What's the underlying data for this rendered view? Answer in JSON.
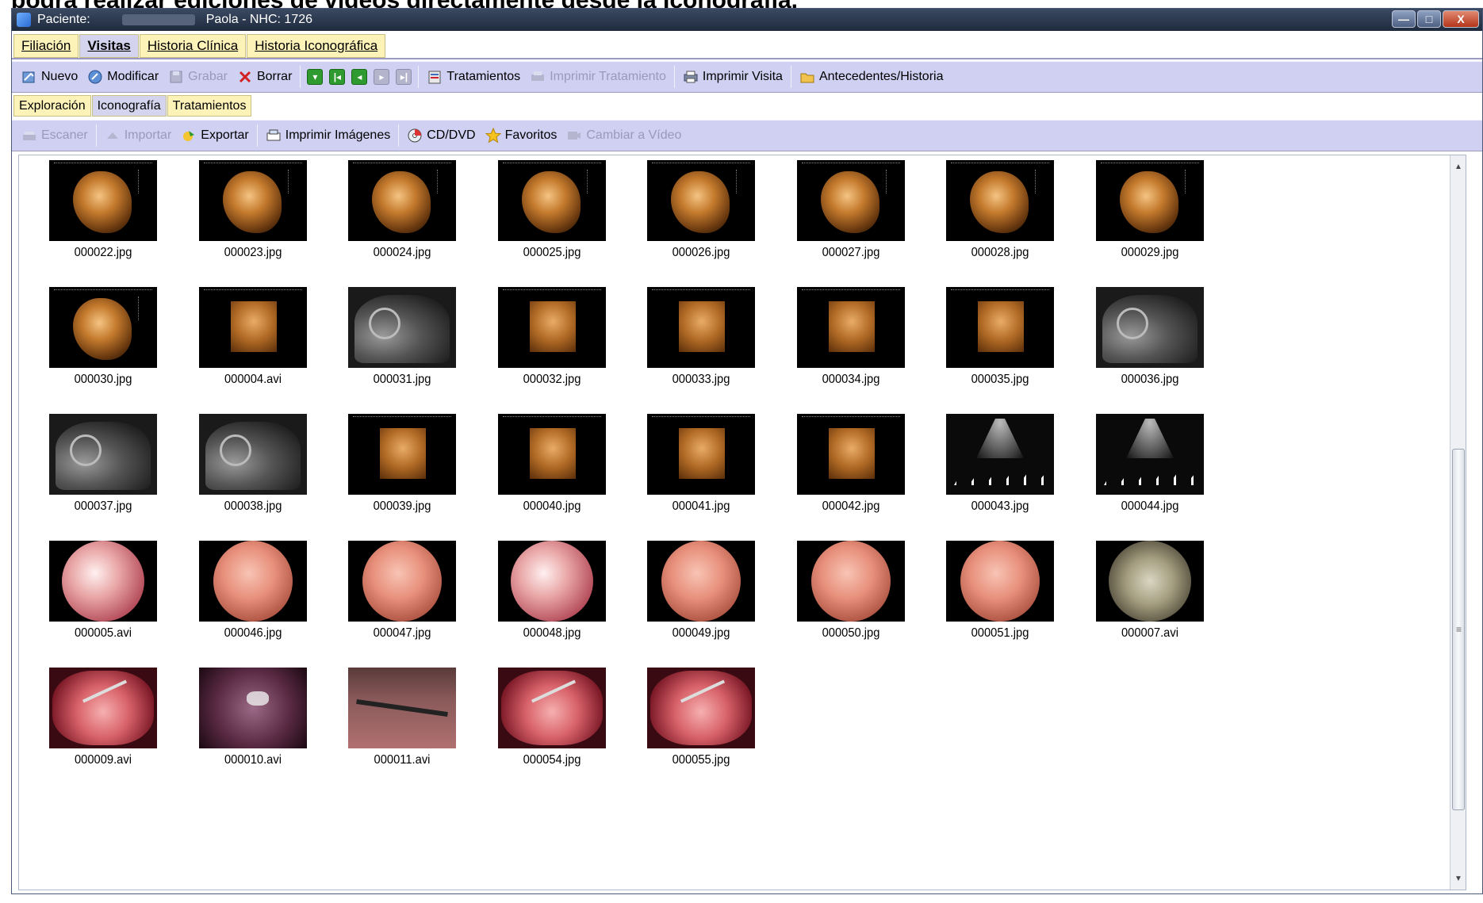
{
  "caption_text": "podrá realizar ediciones de vídeos directamente desde la Iconografía.",
  "window": {
    "title_label": "Paciente:",
    "title_patient": "Paola - NHC: 1726",
    "controls": {
      "minimize": "—",
      "maximize": "□",
      "close": "X"
    }
  },
  "main_tabs": [
    {
      "label": "Filiación",
      "active": false
    },
    {
      "label": "Visitas",
      "active": true
    },
    {
      "label": "Historia Clínica",
      "active": false
    },
    {
      "label": "Historia Iconográfica",
      "active": false
    }
  ],
  "toolbar1": {
    "nuevo": "Nuevo",
    "modificar": "Modificar",
    "grabar": "Grabar",
    "borrar": "Borrar",
    "tratamientos": "Tratamientos",
    "imprimir_tratamiento": "Imprimir Tratamiento",
    "imprimir_visita": "Imprimir Visita",
    "antecedentes": "Antecedentes/Historia"
  },
  "sub_tabs": [
    {
      "label": "Exploración",
      "active": false
    },
    {
      "label": "Iconografía",
      "active": true
    },
    {
      "label": "Tratamientos",
      "active": false
    }
  ],
  "toolbar2": {
    "escaner": "Escaner",
    "importar": "Importar",
    "exportar": "Exportar",
    "imprimir_imagenes": "Imprimir Imágenes",
    "cd_dvd": "CD/DVD",
    "favoritos": "Favoritos",
    "cambiar_video": "Cambiar a Vídeo"
  },
  "gallery": {
    "files": [
      "000022.jpg",
      "000023.jpg",
      "000024.jpg",
      "000025.jpg",
      "000026.jpg",
      "000027.jpg",
      "000028.jpg",
      "000029.jpg",
      "000030.jpg",
      "000004.avi",
      "000031.jpg",
      "000032.jpg",
      "000033.jpg",
      "000034.jpg",
      "000035.jpg",
      "000036.jpg",
      "000037.jpg",
      "000038.jpg",
      "000039.jpg",
      "000040.jpg",
      "000041.jpg",
      "000042.jpg",
      "000043.jpg",
      "000044.jpg",
      "000005.avi",
      "000046.jpg",
      "000047.jpg",
      "000048.jpg",
      "000049.jpg",
      "000050.jpg",
      "000051.jpg",
      "000007.avi",
      "000009.avi",
      "000010.avi",
      "000011.avi",
      "000054.jpg",
      "000055.jpg"
    ]
  },
  "icons": {
    "nuevo": "new-record-icon",
    "modificar": "edit-icon",
    "grabar": "save-icon",
    "borrar": "delete-icon",
    "tratamientos": "treatments-icon",
    "imprimir_tratamiento": "print-treatment-icon",
    "imprimir_visita": "printer-icon",
    "antecedentes": "folder-icon",
    "escaner": "scanner-icon",
    "importar": "import-icon",
    "exportar": "export-icon",
    "imprimir_imagenes": "print-images-icon",
    "cd_dvd": "cd-icon",
    "favoritos": "star-icon",
    "cambiar_video": "video-icon"
  },
  "colors": {
    "toolbar_bg": "#d0d0f3",
    "tab_bg": "#fdf3b9",
    "active_tab_bg": "#d4d4ee",
    "titlebar": "#1f2a3d"
  }
}
